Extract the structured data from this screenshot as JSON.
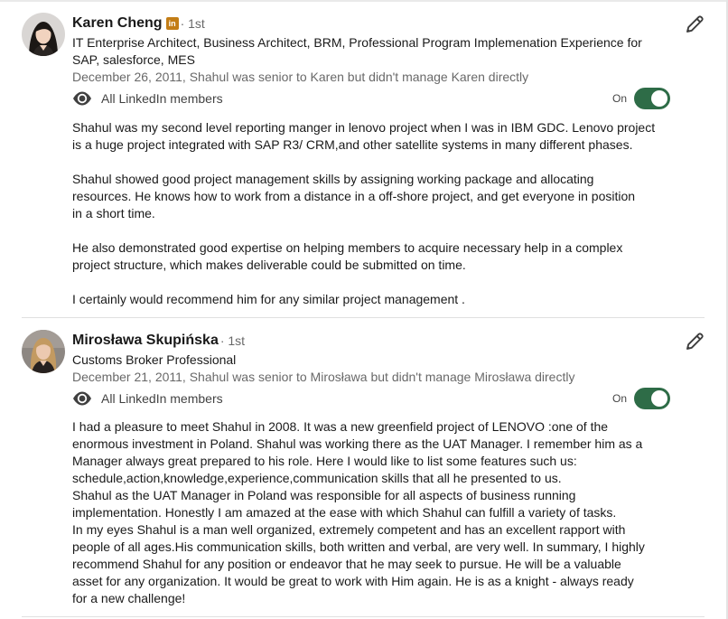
{
  "recommendations": [
    {
      "name": "Karen Cheng",
      "linkedin_badge": "in",
      "degree": "· 1st",
      "headline_lines": [
        "IT Enterprise Architect, Business Architect, BRM, Professional Program Implemenation Experience for",
        "SAP, salesforce, MES"
      ],
      "date": "December 26, 2011, Shahul was senior to Karen but didn't manage Karen directly",
      "visibility": "All LinkedIn members",
      "toggle_label": "On",
      "toggle_on": true,
      "paragraphs": [
        [
          "Shahul was my second level reporting manger in lenovo project when I was in IBM GDC. Lenovo project",
          "is a huge project integrated with SAP R3/ CRM,and other satellite systems in many different phases."
        ],
        [
          "Shahul showed good project management skills by assigning working package and allocating",
          "resources. He knows how to work from a distance in a off-shore project, and get everyone in position",
          "in a short time."
        ],
        [
          "He also demonstrated good expertise on helping members to acquire necessary help in a complex",
          "project structure, which makes deliverable could be submitted on time."
        ],
        [
          "I certainly would recommend him for any similar project management ."
        ]
      ]
    },
    {
      "name": "Mirosława Skupińska",
      "degree": "· 1st",
      "headline_lines": [
        "Customs Broker Professional"
      ],
      "date": "December 21, 2011, Shahul was senior to Mirosława but didn't manage Mirosława directly",
      "visibility": "All LinkedIn members",
      "toggle_label": "On",
      "toggle_on": true,
      "paragraphs": [
        [
          "I had a pleasure to meet Shahul in 2008. It was a new greenfield project of LENOVO :one of the",
          "enormous investment in Poland. Shahul was working there as the UAT Manager. I remember him as a",
          "Manager always great prepared to his role. Here I would like to list some features such us:",
          "schedule,action,knowledge,experience,communication skills that all he presented to us.",
          "Shahul as the UAT Manager in Poland was responsible for all aspects of business running",
          "implementation. Honestly I am amazed at the ease with which Shahul can fulfill a variety of tasks.",
          "In my eyes Shahul is a man well organized, extremely competent and has an excellent rapport with",
          "people of all ages.His communication skills, both written and verbal, are very well. In summary, I highly",
          "recommend Shahul for any position or endeavor that he may seek to pursue. He will be a valuable",
          "asset for any organization. It would be great to work with Him again. He is as a knight - always ready",
          "for a new challenge!"
        ]
      ]
    }
  ],
  "icons": {
    "visibility": "eye-icon",
    "edit": "pencil-icon"
  },
  "colors": {
    "toggle_on": "#2e6c47",
    "badge": "#c37d16"
  }
}
